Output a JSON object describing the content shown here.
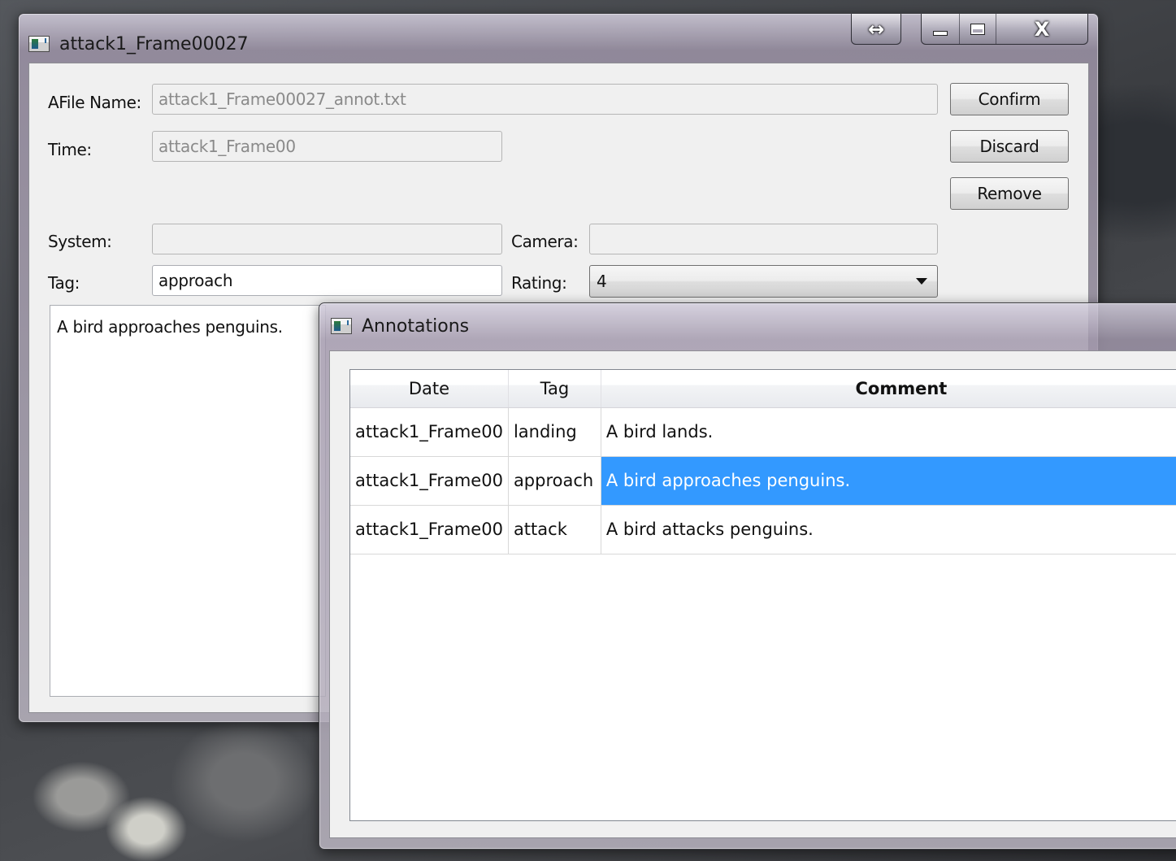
{
  "editor_window": {
    "title": "attack1_Frame00027",
    "caption_buttons": {
      "extend_icon": "↔",
      "minimize_icon": "minimize-icon",
      "maximize_icon": "maximize-icon",
      "close_icon": "X"
    },
    "fields": {
      "afile_name_label": "AFile Name:",
      "afile_name_value": "attack1_Frame00027_annot.txt",
      "time_label": "Time:",
      "time_value": "attack1_Frame00",
      "system_label": "System:",
      "system_value": "",
      "camera_label": "Camera:",
      "camera_value": "",
      "tag_label": "Tag:",
      "tag_value": "approach",
      "rating_label": "Rating:",
      "rating_value": "4"
    },
    "comment_text": "A bird approaches penguins.",
    "buttons": {
      "confirm": "Confirm",
      "discard": "Discard",
      "remove": "Remove"
    }
  },
  "annotations_window": {
    "title": "Annotations",
    "columns": [
      "Date",
      "Tag",
      "Comment"
    ],
    "rows": [
      {
        "date": "attack1_Frame00",
        "tag": "landing",
        "comment": "A bird lands."
      },
      {
        "date": "attack1_Frame00",
        "tag": "approach",
        "comment": "A bird approaches penguins."
      },
      {
        "date": "attack1_Frame00",
        "tag": "attack",
        "comment": "A bird attacks penguins."
      }
    ],
    "selected_row": 1,
    "selection_color": "#3399ff"
  }
}
